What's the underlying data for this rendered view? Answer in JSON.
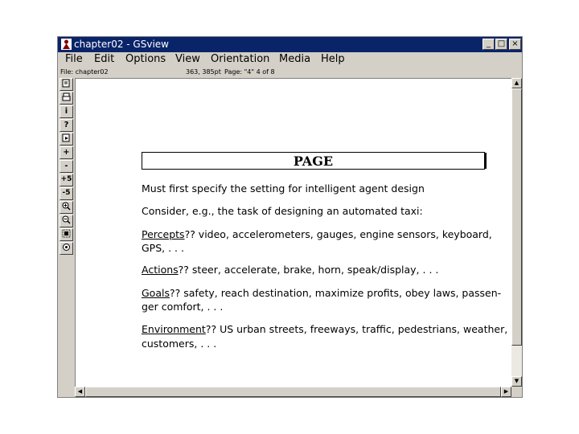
{
  "window": {
    "title": "chapter02 - GSview",
    "controls": {
      "minimize": "_",
      "maximize": "□",
      "close": "×"
    }
  },
  "menu": [
    "File",
    "Edit",
    "Options",
    "View",
    "Orientation",
    "Media",
    "Help"
  ],
  "status": {
    "file": "File: chapter02",
    "coords": "363, 385pt",
    "page": "Page: \"4\"  4 of  8"
  },
  "toolbar": [
    "open-icon",
    "print-icon",
    "info-icon",
    "help-icon",
    "goto-page-icon",
    "next-page-icon",
    "prev-page-icon",
    "skip-forward-5-icon",
    "skip-back-5-icon",
    "zoom-in-icon",
    "zoom-out-icon",
    "fit-page-icon",
    "magnify-icon"
  ],
  "toolbar_glyphs": {
    "info": "i",
    "help": "?",
    "next": "+",
    "prev": "-",
    "skip_fwd": "+5",
    "skip_back": "-5"
  },
  "slide": {
    "title": "PAGE",
    "line1": "Must first specify the setting for intelligent agent design",
    "line2": "Consider, e.g., the task of designing an automated taxi:",
    "percepts_label": "Percepts",
    "percepts_text": "??   video, accelerometers, gauges, engine sensors, keyboard,",
    "percepts_text2": "GPS, . . .",
    "actions_label": "Actions",
    "actions_text": "?? steer, accelerate, brake, horn, speak/display, . . .",
    "goals_label": "Goals",
    "goals_text": "?? safety, reach destination, maximize profits, obey laws, passen-",
    "goals_text2": "ger comfort, . . .",
    "env_label": "Environment",
    "env_text": "?? US urban streets, freeways, traffic, pedestrians, weather,",
    "env_text2": "customers, . . ."
  }
}
